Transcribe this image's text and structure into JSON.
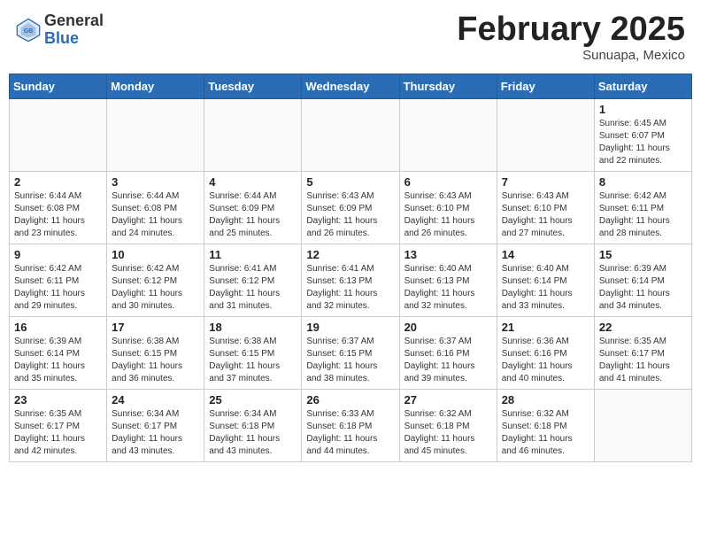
{
  "header": {
    "logo_general": "General",
    "logo_blue": "Blue",
    "month_title": "February 2025",
    "subtitle": "Sunuapa, Mexico"
  },
  "calendar": {
    "days_of_week": [
      "Sunday",
      "Monday",
      "Tuesday",
      "Wednesday",
      "Thursday",
      "Friday",
      "Saturday"
    ],
    "weeks": [
      [
        {
          "day": "",
          "info": ""
        },
        {
          "day": "",
          "info": ""
        },
        {
          "day": "",
          "info": ""
        },
        {
          "day": "",
          "info": ""
        },
        {
          "day": "",
          "info": ""
        },
        {
          "day": "",
          "info": ""
        },
        {
          "day": "1",
          "info": "Sunrise: 6:45 AM\nSunset: 6:07 PM\nDaylight: 11 hours\nand 22 minutes."
        }
      ],
      [
        {
          "day": "2",
          "info": "Sunrise: 6:44 AM\nSunset: 6:08 PM\nDaylight: 11 hours\nand 23 minutes."
        },
        {
          "day": "3",
          "info": "Sunrise: 6:44 AM\nSunset: 6:08 PM\nDaylight: 11 hours\nand 24 minutes."
        },
        {
          "day": "4",
          "info": "Sunrise: 6:44 AM\nSunset: 6:09 PM\nDaylight: 11 hours\nand 25 minutes."
        },
        {
          "day": "5",
          "info": "Sunrise: 6:43 AM\nSunset: 6:09 PM\nDaylight: 11 hours\nand 26 minutes."
        },
        {
          "day": "6",
          "info": "Sunrise: 6:43 AM\nSunset: 6:10 PM\nDaylight: 11 hours\nand 26 minutes."
        },
        {
          "day": "7",
          "info": "Sunrise: 6:43 AM\nSunset: 6:10 PM\nDaylight: 11 hours\nand 27 minutes."
        },
        {
          "day": "8",
          "info": "Sunrise: 6:42 AM\nSunset: 6:11 PM\nDaylight: 11 hours\nand 28 minutes."
        }
      ],
      [
        {
          "day": "9",
          "info": "Sunrise: 6:42 AM\nSunset: 6:11 PM\nDaylight: 11 hours\nand 29 minutes."
        },
        {
          "day": "10",
          "info": "Sunrise: 6:42 AM\nSunset: 6:12 PM\nDaylight: 11 hours\nand 30 minutes."
        },
        {
          "day": "11",
          "info": "Sunrise: 6:41 AM\nSunset: 6:12 PM\nDaylight: 11 hours\nand 31 minutes."
        },
        {
          "day": "12",
          "info": "Sunrise: 6:41 AM\nSunset: 6:13 PM\nDaylight: 11 hours\nand 32 minutes."
        },
        {
          "day": "13",
          "info": "Sunrise: 6:40 AM\nSunset: 6:13 PM\nDaylight: 11 hours\nand 32 minutes."
        },
        {
          "day": "14",
          "info": "Sunrise: 6:40 AM\nSunset: 6:14 PM\nDaylight: 11 hours\nand 33 minutes."
        },
        {
          "day": "15",
          "info": "Sunrise: 6:39 AM\nSunset: 6:14 PM\nDaylight: 11 hours\nand 34 minutes."
        }
      ],
      [
        {
          "day": "16",
          "info": "Sunrise: 6:39 AM\nSunset: 6:14 PM\nDaylight: 11 hours\nand 35 minutes."
        },
        {
          "day": "17",
          "info": "Sunrise: 6:38 AM\nSunset: 6:15 PM\nDaylight: 11 hours\nand 36 minutes."
        },
        {
          "day": "18",
          "info": "Sunrise: 6:38 AM\nSunset: 6:15 PM\nDaylight: 11 hours\nand 37 minutes."
        },
        {
          "day": "19",
          "info": "Sunrise: 6:37 AM\nSunset: 6:15 PM\nDaylight: 11 hours\nand 38 minutes."
        },
        {
          "day": "20",
          "info": "Sunrise: 6:37 AM\nSunset: 6:16 PM\nDaylight: 11 hours\nand 39 minutes."
        },
        {
          "day": "21",
          "info": "Sunrise: 6:36 AM\nSunset: 6:16 PM\nDaylight: 11 hours\nand 40 minutes."
        },
        {
          "day": "22",
          "info": "Sunrise: 6:35 AM\nSunset: 6:17 PM\nDaylight: 11 hours\nand 41 minutes."
        }
      ],
      [
        {
          "day": "23",
          "info": "Sunrise: 6:35 AM\nSunset: 6:17 PM\nDaylight: 11 hours\nand 42 minutes."
        },
        {
          "day": "24",
          "info": "Sunrise: 6:34 AM\nSunset: 6:17 PM\nDaylight: 11 hours\nand 43 minutes."
        },
        {
          "day": "25",
          "info": "Sunrise: 6:34 AM\nSunset: 6:18 PM\nDaylight: 11 hours\nand 43 minutes."
        },
        {
          "day": "26",
          "info": "Sunrise: 6:33 AM\nSunset: 6:18 PM\nDaylight: 11 hours\nand 44 minutes."
        },
        {
          "day": "27",
          "info": "Sunrise: 6:32 AM\nSunset: 6:18 PM\nDaylight: 11 hours\nand 45 minutes."
        },
        {
          "day": "28",
          "info": "Sunrise: 6:32 AM\nSunset: 6:18 PM\nDaylight: 11 hours\nand 46 minutes."
        },
        {
          "day": "",
          "info": ""
        }
      ]
    ]
  }
}
